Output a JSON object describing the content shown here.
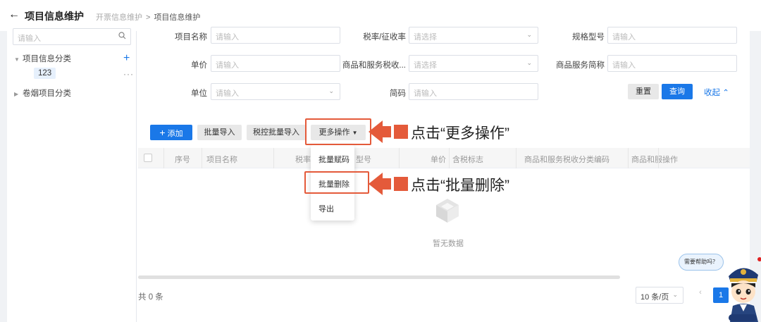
{
  "header": {
    "back_icon": "arrow-left-icon",
    "title": "项目信息维护",
    "breadcrumb": [
      "开票信息维护",
      "项目信息维护"
    ],
    "breadcrumb_sep": ">"
  },
  "sidebar": {
    "search_placeholder": "请输入",
    "tree": [
      {
        "label": "项目信息分类",
        "expanded": true,
        "children": [
          {
            "label": "123"
          }
        ]
      },
      {
        "label": "卷烟项目分类",
        "expanded": false,
        "children": []
      }
    ]
  },
  "filters": {
    "row1": [
      {
        "label": "项目名称",
        "placeholder": "请输入"
      },
      {
        "label": "税率/征收率",
        "placeholder": "请选择"
      },
      {
        "label": "规格型号",
        "placeholder": "请输入"
      }
    ],
    "row2": [
      {
        "label": "单价",
        "placeholder": "请输入"
      },
      {
        "label": "商品和服务税收...",
        "placeholder": "请选择"
      },
      {
        "label": "商品服务简称",
        "placeholder": "请输入"
      }
    ],
    "row3": [
      {
        "label": "单位",
        "placeholder": "请输入"
      },
      {
        "label": "简码",
        "placeholder": "请输入"
      }
    ],
    "reset": "重置",
    "query": "查询",
    "collapse": "收起"
  },
  "toolbar": {
    "add": "添加",
    "batch_import": "批量导入",
    "tax_batch_import": "税控批量导入",
    "more": "更多操作"
  },
  "dropdown": {
    "items": [
      "批量赋码",
      "批量删除",
      "导出"
    ]
  },
  "table": {
    "columns": [
      "序号",
      "项目名称",
      "税率",
      "型号",
      "单价",
      "含税标志",
      "商品和服务税收分类编码",
      "商品和服",
      "操作"
    ],
    "empty_text": "暂无数据"
  },
  "annotations": {
    "more": "点击“更多操作”",
    "delete": "点击“批量删除”",
    "color": "#e45a3a"
  },
  "pagination": {
    "total": "共 0 条",
    "page_size": "10 条/页",
    "current_page": "1"
  },
  "help": {
    "bubble": "需要帮助吗？"
  },
  "colors": {
    "primary": "#1a78e8",
    "annotation_red": "#e45a3a"
  }
}
